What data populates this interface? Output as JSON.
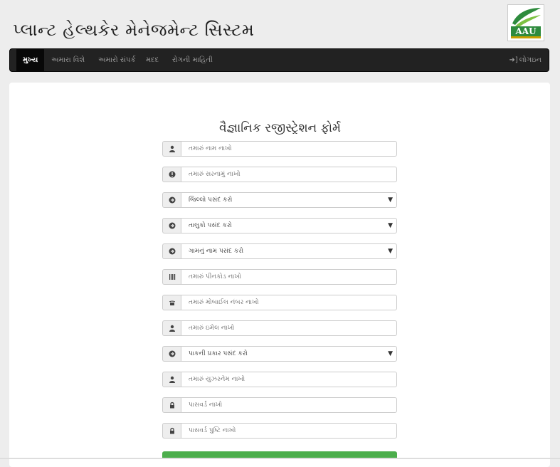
{
  "site": {
    "title": "પ્લાન્ટ હેલ્થકેર મેનેજમેન્ટ સિસ્ટમ",
    "logo_text": "AAU",
    "logo_color": "#2e8b3d"
  },
  "nav": {
    "items": [
      {
        "label": "મુખ્ય",
        "active": true
      },
      {
        "label": "અમારા વિશે",
        "active": false
      },
      {
        "label": "અમારો સંપર્ક",
        "active": false
      },
      {
        "label": "મદદ",
        "active": false
      },
      {
        "label": "રોગની માહિતી",
        "active": false
      }
    ],
    "login_label": "લોગઇન",
    "login_icon": "login-icon"
  },
  "form": {
    "title": "વૈજ્ઞાનિક રજીસ્ટ્રેશન ફોર્મ",
    "fields": [
      {
        "type": "input",
        "icon": "user-icon",
        "placeholder": "તમારું નામ નાખો"
      },
      {
        "type": "input",
        "icon": "info-icon",
        "placeholder": "તમારું સરનામું નાખો"
      },
      {
        "type": "select",
        "icon": "circle-arrow-icon",
        "value": "જિલ્લો પસંદ કરો"
      },
      {
        "type": "select",
        "icon": "circle-arrow-icon",
        "value": "તાલુકો પસંદ કરો"
      },
      {
        "type": "select",
        "icon": "circle-arrow-icon",
        "value": "ગામનું નામ પસંદ કરો"
      },
      {
        "type": "input",
        "icon": "barcode-icon",
        "placeholder": "તમારું પીનકોડ નાખો"
      },
      {
        "type": "input",
        "icon": "phone-icon",
        "placeholder": "તમારું મોબાઈલ નંબર નાખો"
      },
      {
        "type": "input",
        "icon": "user-icon",
        "placeholder": "તમારું ઇમેલ નાખો"
      },
      {
        "type": "select",
        "icon": "circle-arrow-icon",
        "value": "પાકની પ્રકાર પસંદ કરો"
      },
      {
        "type": "input",
        "icon": "user-icon",
        "placeholder": "તમારું યુઝરનેમ નાખો"
      },
      {
        "type": "input",
        "icon": "lock-icon",
        "placeholder": "પાસવર્ડ નાખો"
      },
      {
        "type": "input",
        "icon": "lock-icon",
        "placeholder": "પાસવર્ડ પુષ્ટિ નાખો"
      }
    ],
    "submit_color": "#4cae4c"
  }
}
